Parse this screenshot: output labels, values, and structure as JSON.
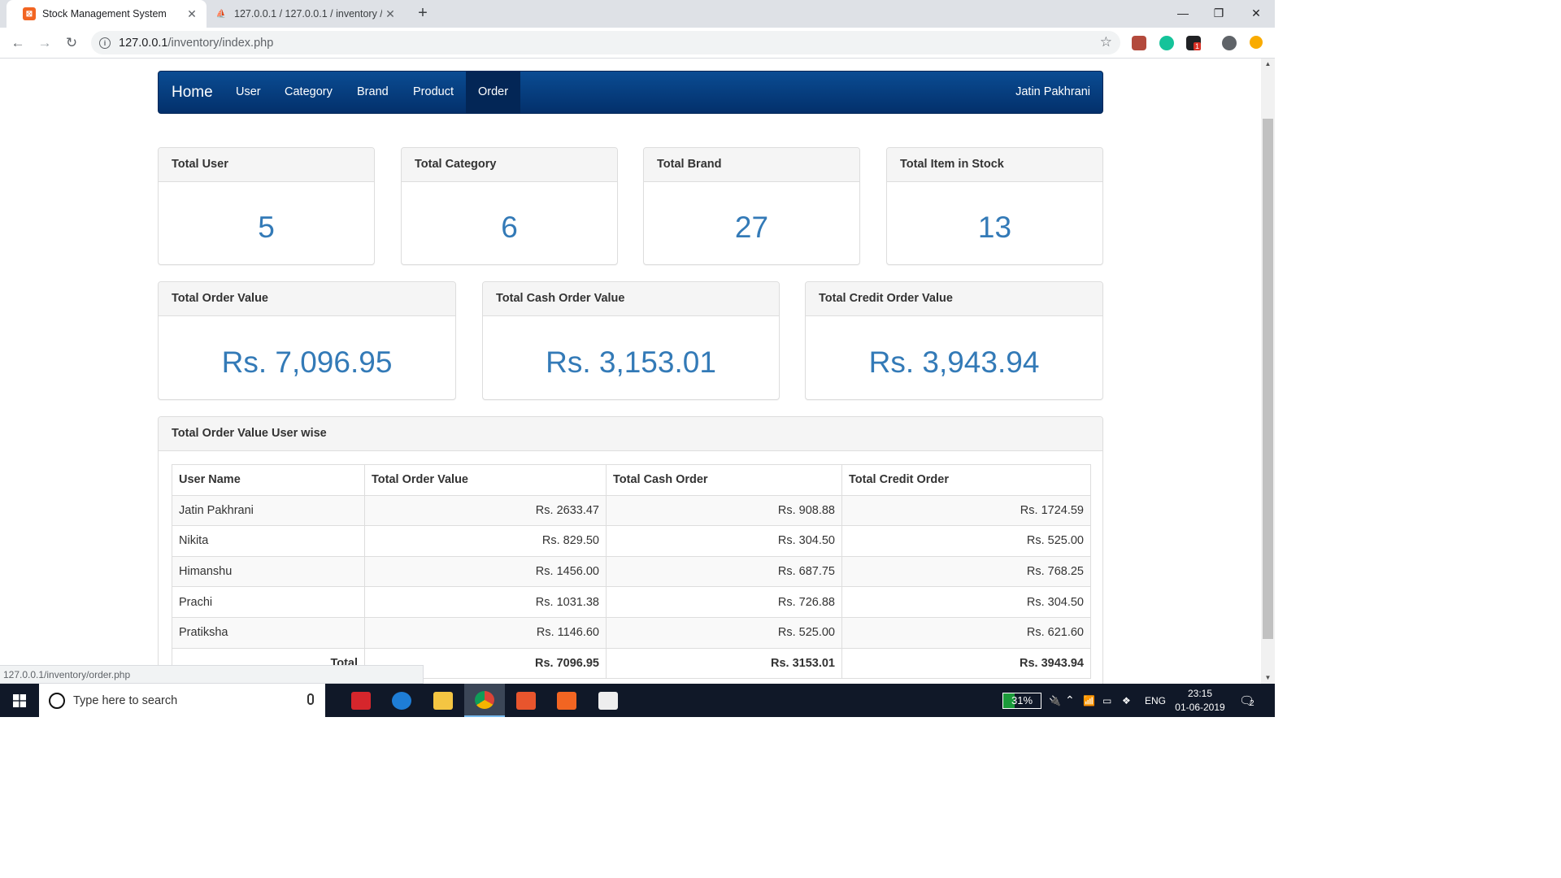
{
  "browser": {
    "tabs": [
      {
        "title": "Stock Management System",
        "close": "✕",
        "active": true
      },
      {
        "title": "127.0.0.1 / 127.0.0.1 / inventory / ",
        "close": "✕",
        "active": false
      }
    ],
    "new_tab": "+",
    "url_host": "127.0.0.1",
    "url_path": "/inventory/index.php",
    "window_controls": {
      "minimize": "—",
      "maximize": "❐",
      "close": "✕"
    },
    "extension_badge": "1"
  },
  "page": {
    "navbar": {
      "brand": "Home",
      "items": [
        "User",
        "Category",
        "Brand",
        "Product",
        "Order"
      ],
      "active_item": "Order",
      "user": "Jatin Pakhrani"
    },
    "stats": [
      {
        "title": "Total User",
        "value": "5"
      },
      {
        "title": "Total Category",
        "value": "6"
      },
      {
        "title": "Total Brand",
        "value": "27"
      },
      {
        "title": "Total Item in Stock",
        "value": "13"
      }
    ],
    "order_values": [
      {
        "title": "Total Order Value",
        "value": "Rs. 7,096.95"
      },
      {
        "title": "Total Cash Order Value",
        "value": "Rs. 3,153.01"
      },
      {
        "title": "Total Credit Order Value",
        "value": "Rs. 3,943.94"
      }
    ],
    "user_wise": {
      "title": "Total Order Value User wise",
      "columns": [
        "User Name",
        "Total Order Value",
        "Total Cash Order",
        "Total Credit Order"
      ],
      "rows": [
        [
          "Jatin Pakhrani",
          "Rs. 2633.47",
          "Rs. 908.88",
          "Rs. 1724.59"
        ],
        [
          "Nikita",
          "Rs. 829.50",
          "Rs. 304.50",
          "Rs. 525.00"
        ],
        [
          "Himanshu",
          "Rs. 1456.00",
          "Rs. 687.75",
          "Rs. 768.25"
        ],
        [
          "Prachi",
          "Rs. 1031.38",
          "Rs. 726.88",
          "Rs. 304.50"
        ],
        [
          "Pratiksha",
          "Rs. 1146.60",
          "Rs. 525.00",
          "Rs. 621.60"
        ]
      ],
      "total": [
        "Total",
        "Rs. 7096.95",
        "Rs. 3153.01",
        "Rs. 3943.94"
      ]
    },
    "status_url": "127.0.0.1/inventory/order.php"
  },
  "taskbar": {
    "search_placeholder": "Type here to search",
    "battery": "31%",
    "battery_level": 0.31,
    "language": "ENG",
    "time": "23:15",
    "date": "01-06-2019",
    "notification_count": "2"
  },
  "colors": {
    "navbar": "#0a4c93",
    "navbar_active": "#032656",
    "value_text": "#337ab7",
    "panel_heading": "#f5f5f5",
    "taskbar": "#101828"
  }
}
